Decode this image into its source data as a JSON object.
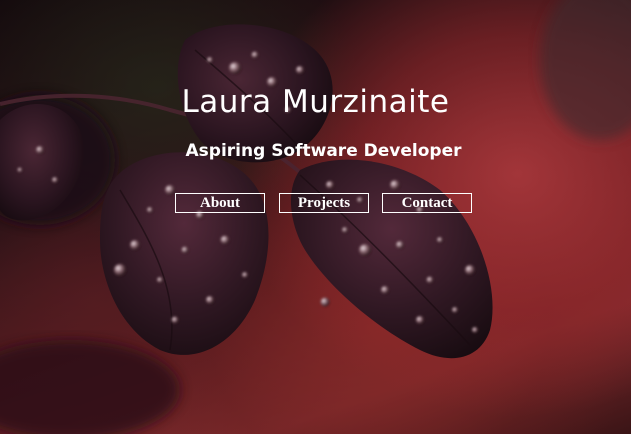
{
  "hero": {
    "title": "Laura Murzinaite",
    "subtitle": "Aspiring Software Developer",
    "background_image": "dark-rose-leaves-with-water-droplets"
  },
  "nav": {
    "items": [
      {
        "label": "About"
      },
      {
        "label": "Projects"
      },
      {
        "label": "Contact"
      }
    ]
  },
  "colors": {
    "text": "#ffffff",
    "leaf": "#2b1520",
    "background_red": "#b03a3e"
  }
}
